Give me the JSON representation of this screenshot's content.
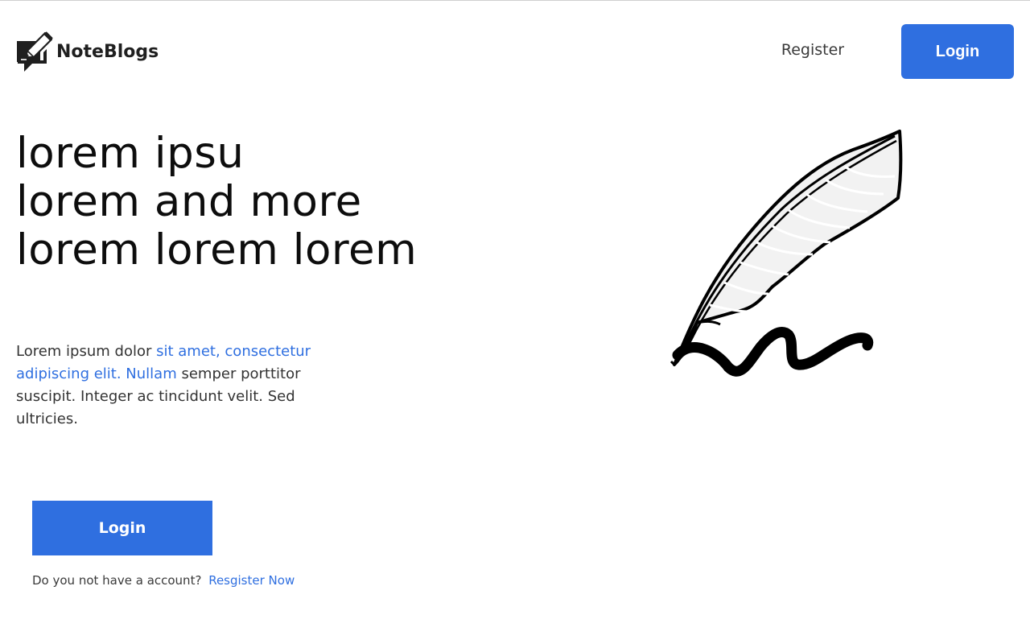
{
  "header": {
    "brand_name": "NoteBlogs",
    "register_label": "Register",
    "login_label": "Login"
  },
  "hero": {
    "title_lines": [
      "lorem ipsu",
      "lorem and more",
      "lorem lorem lorem"
    ],
    "paragraph": {
      "plain_start": "Lorem ipsum dolor ",
      "accent": "sit amet, consectetur adipiscing elit. Nullam",
      "plain_end": " semper porttitor suscipit. Integer ac tincidunt velit. Sed ultricies."
    },
    "login_button_label": "Login",
    "no_account_text": "Do you not have a account?",
    "register_now_label": "Resgister Now"
  },
  "icons": {
    "brand": "note-pencil-icon",
    "illustration": "quill-pen-illustration"
  },
  "colors": {
    "accent": "#2f6fe0",
    "text": "#222222",
    "background": "#ffffff"
  }
}
